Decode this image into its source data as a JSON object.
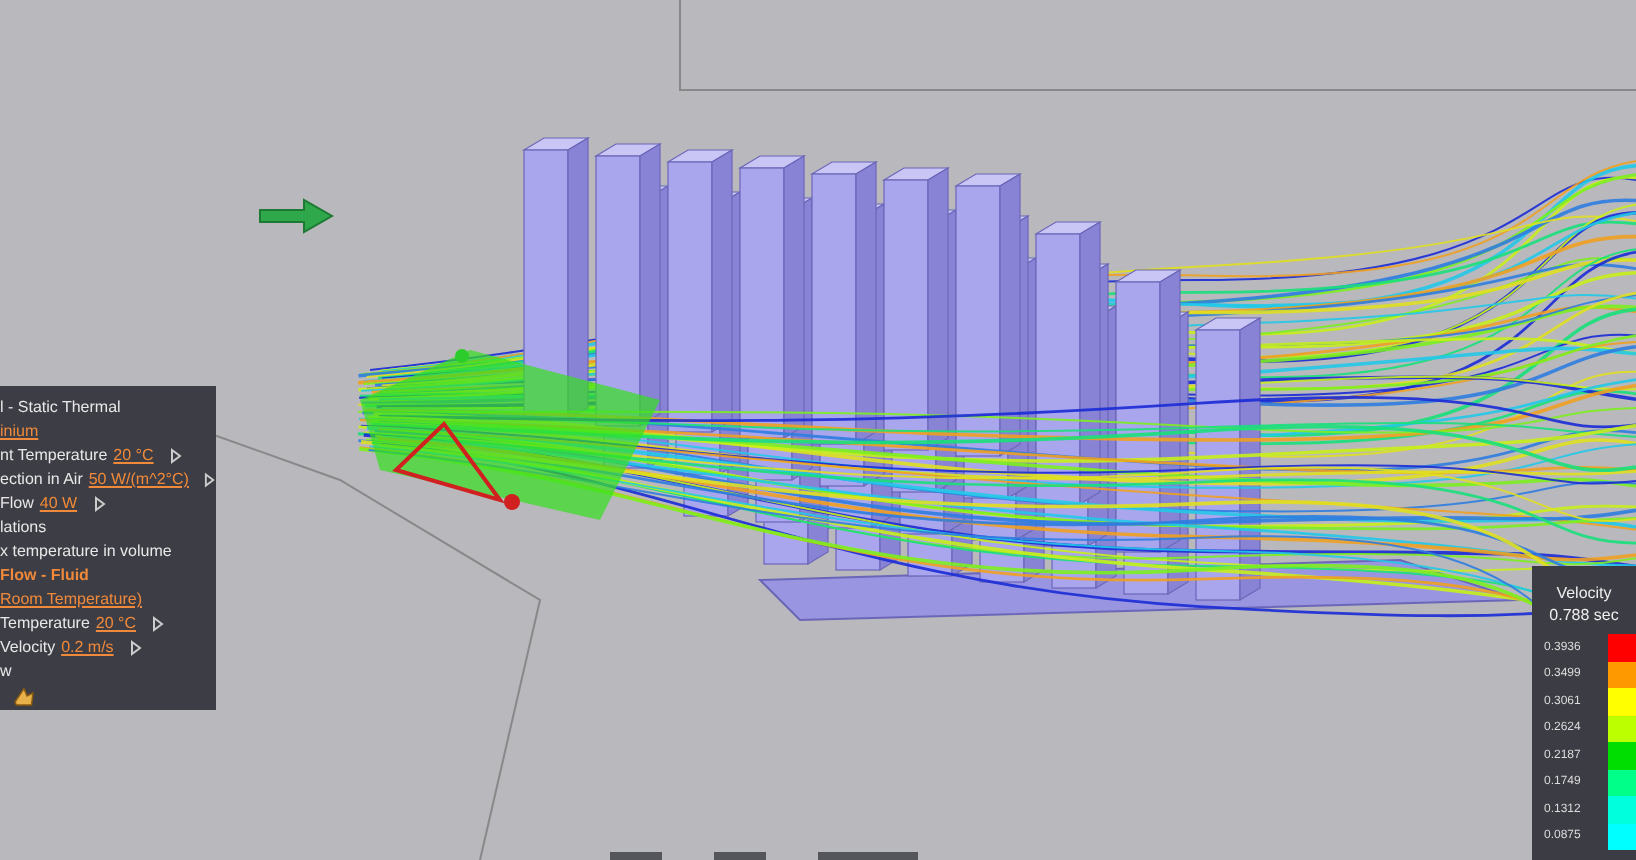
{
  "panel": {
    "rows": [
      {
        "kind": "text",
        "label": "l - Static Thermal"
      },
      {
        "kind": "link",
        "label": "inium"
      },
      {
        "kind": "property",
        "label": "nt Temperature",
        "value": "20 °C"
      },
      {
        "kind": "property",
        "label": "ection in Air",
        "value": "50 W/(m^2°C)"
      },
      {
        "kind": "property",
        "label": "Flow",
        "value": "40 W"
      },
      {
        "kind": "text",
        "label": "lations"
      },
      {
        "kind": "text",
        "label": "x temperature in volume"
      },
      {
        "kind": "heading",
        "label": "Flow - Fluid"
      },
      {
        "kind": "link",
        "label": "Room Temperature)"
      },
      {
        "kind": "property",
        "label": "Temperature",
        "value": "20 °C"
      },
      {
        "kind": "property",
        "label": "Velocity",
        "value": "0.2 m/s"
      },
      {
        "kind": "text",
        "label": "w"
      },
      {
        "kind": "icons"
      }
    ]
  },
  "legend": {
    "title": "Velocity",
    "time": "0.788 sec",
    "bands": [
      {
        "label": "0.3936",
        "color": "#ff0000"
      },
      {
        "label": "0.3499",
        "color": "#ff9900"
      },
      {
        "label": "0.3061",
        "color": "#ffff00"
      },
      {
        "label": "0.2624",
        "color": "#bbff00"
      },
      {
        "label": "0.2187",
        "color": "#00dd00"
      },
      {
        "label": "0.1749",
        "color": "#00ff88"
      },
      {
        "label": "0.1312",
        "color": "#00ffdd"
      },
      {
        "label": "0.0875",
        "color": "#00ffff"
      }
    ]
  }
}
